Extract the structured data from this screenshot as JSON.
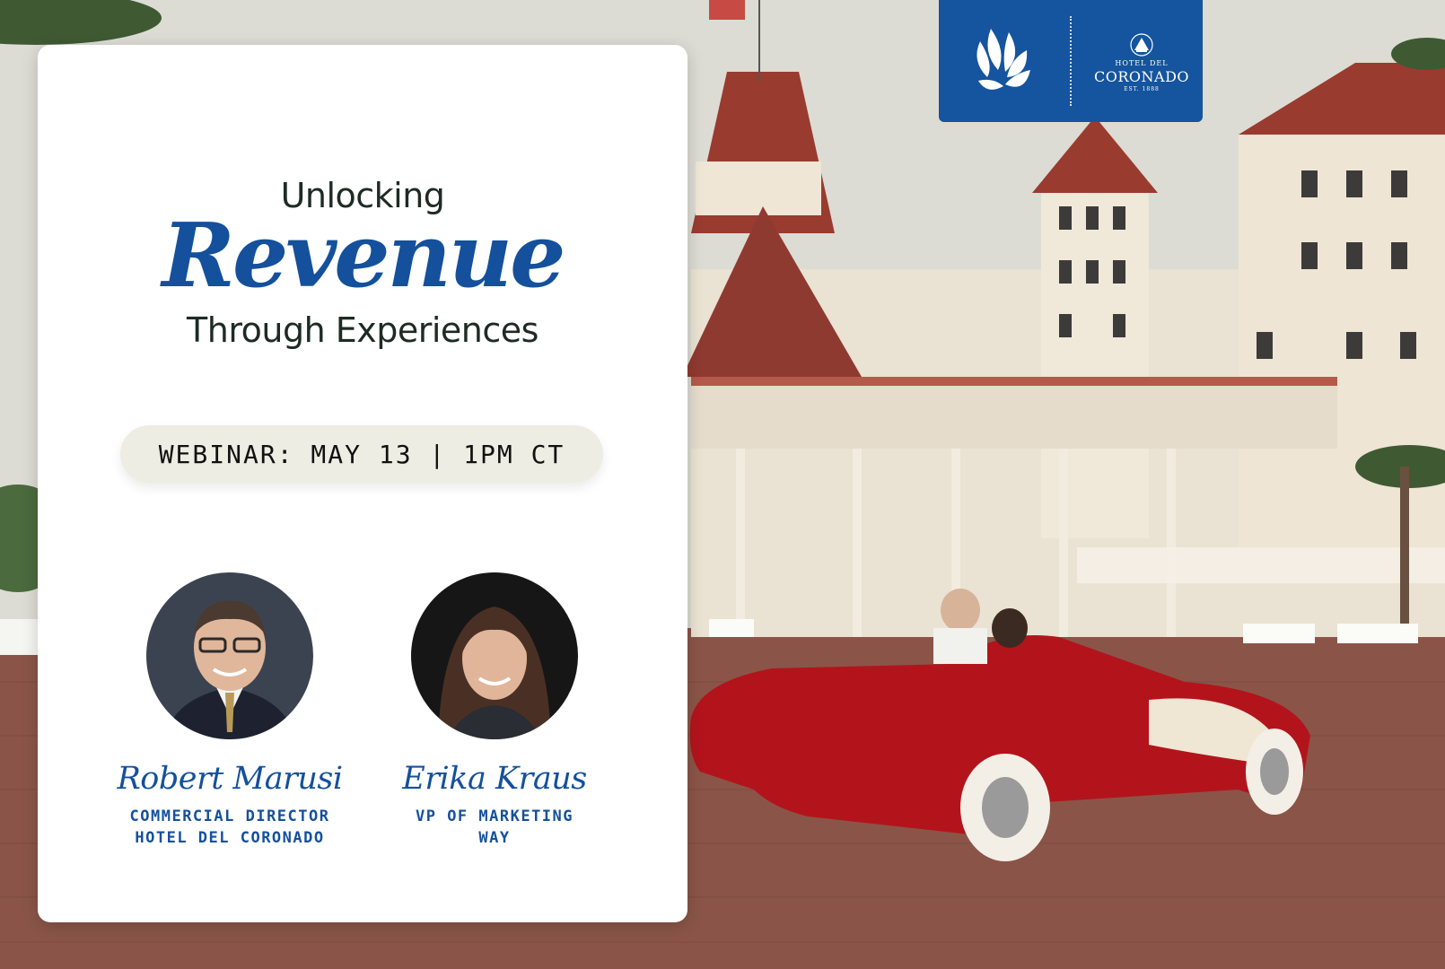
{
  "headline": {
    "top": "Unlocking",
    "main": "Revenue",
    "bottom": "Through Experiences"
  },
  "event": {
    "label": "WEBINAR: MAY 13 | 1PM CT"
  },
  "speakers": [
    {
      "name": "Robert Marusi",
      "role_line1": "COMMERCIAL DIRECTOR",
      "role_line2": "HOTEL DEL CORONADO"
    },
    {
      "name": "Erika Kraus",
      "role_line1": "VP OF MARKETING",
      "role_line2": "WAY"
    }
  ],
  "logo": {
    "brand_icon": "lotus-petals-icon",
    "partner_top": "HOTEL DEL",
    "partner_name": "CORONADO",
    "partner_est": "EST. 1888"
  },
  "colors": {
    "accent": "#14509c",
    "badge": "#15549e",
    "card": "#ffffff",
    "pill": "#ededE4"
  }
}
